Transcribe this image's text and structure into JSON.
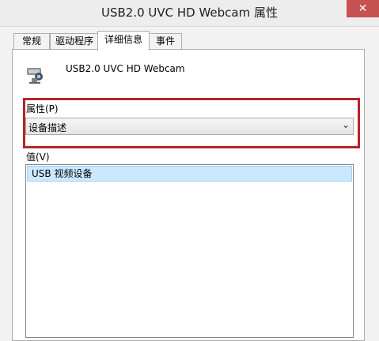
{
  "window": {
    "title": "USB2.0 UVC HD Webcam 属性"
  },
  "tabs": [
    {
      "label": "常规"
    },
    {
      "label": "驱动程序"
    },
    {
      "label": "详细信息",
      "active": true
    },
    {
      "label": "事件"
    }
  ],
  "device": {
    "name": "USB2.0 UVC HD Webcam",
    "icon": "webcam-icon"
  },
  "property": {
    "label": "属性(P)",
    "selected": "设备描述"
  },
  "value": {
    "label": "值(V)",
    "items": [
      "USB 视频设备"
    ]
  },
  "colors": {
    "highlight_border": "#b4262a",
    "selection_bg": "#cce8ff",
    "close_button": "#c75050"
  }
}
